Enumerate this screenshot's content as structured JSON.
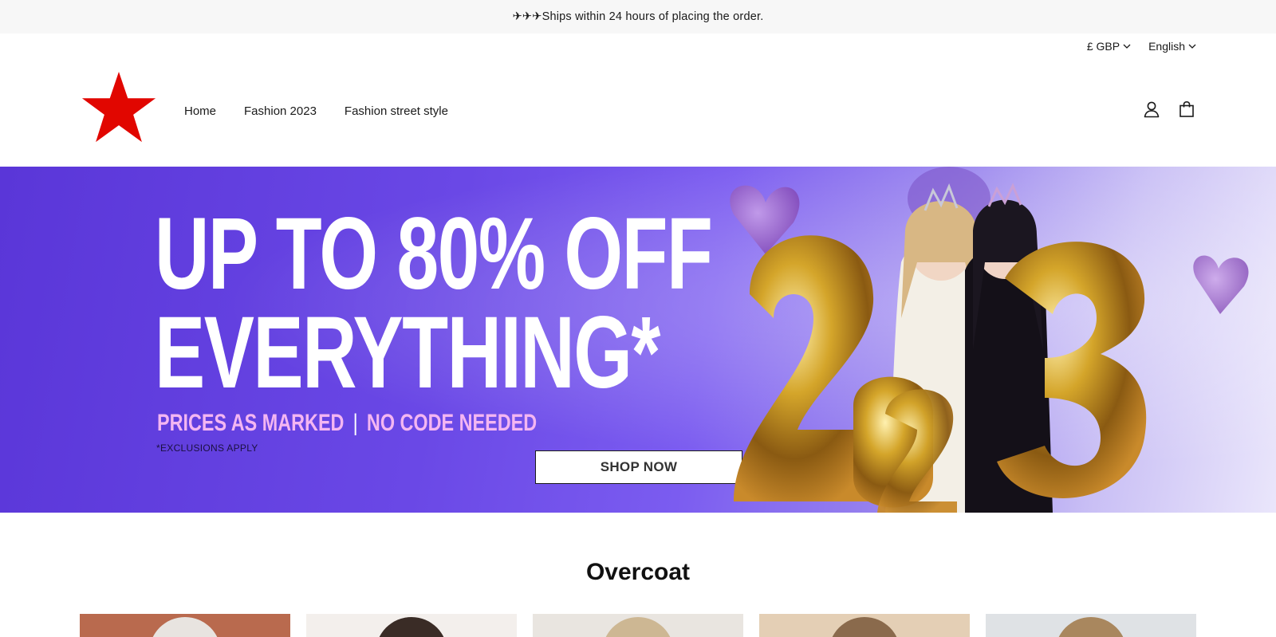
{
  "announcement": {
    "text": "✈✈✈Ships within 24 hours of placing the order."
  },
  "localization": {
    "currency": "£ GBP",
    "language": "English"
  },
  "nav": {
    "items": [
      "Home",
      "Fashion 2023",
      "Fashion street style"
    ]
  },
  "colors": {
    "logo_red": "#e10600",
    "hero_purple": "#6a48e6",
    "hero_pink_text": "#f4b6f2"
  },
  "hero": {
    "headline_line1": "UP TO 80% OFF",
    "headline_line2": "EVERYTHING*",
    "subline_left": "PRICES AS MARKED",
    "subline_sep": "|",
    "subline_right": "NO CODE NEEDED",
    "note": "*EXCLUSIONS APPLY",
    "button_label": "SHOP NOW",
    "balloons": "2023"
  },
  "section": {
    "title": "Overcoat"
  },
  "products": [
    {
      "bg": "#b96a4e",
      "face": "#e8e4e0"
    },
    {
      "bg": "#f3efec",
      "face": "#3a2c26"
    },
    {
      "bg": "#e9e5e0",
      "face": "#cdb793"
    },
    {
      "bg": "#e4cfb5",
      "face": "#8a6a4c"
    },
    {
      "bg": "#dfe2e5",
      "face": "#a9875e"
    }
  ]
}
